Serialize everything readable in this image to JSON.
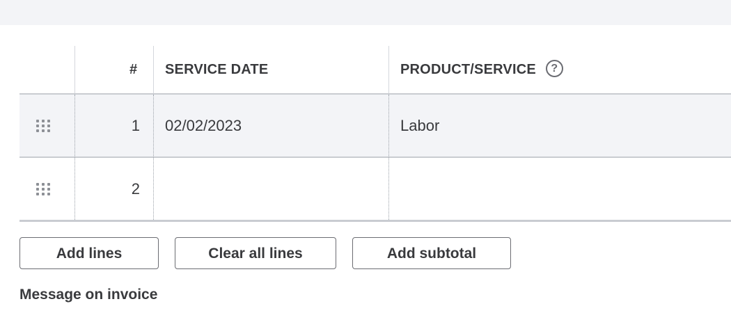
{
  "table": {
    "headers": {
      "number": "#",
      "service_date": "SERVICE DATE",
      "product_service": "PRODUCT/SERVICE",
      "help_glyph": "?"
    },
    "rows": [
      {
        "number": "1",
        "service_date": "02/02/2023",
        "product_service": "Labor"
      },
      {
        "number": "2",
        "service_date": "",
        "product_service": ""
      }
    ]
  },
  "actions": {
    "add_lines": "Add lines",
    "clear_all_lines": "Clear all lines",
    "add_subtotal": "Add subtotal"
  },
  "message_section": {
    "label": "Message on invoice"
  },
  "icons": {
    "drag_handle": "drag-handle-icon",
    "help": "help-circle-icon"
  },
  "colors": {
    "top_band": "#f3f4f7",
    "selected_row": "#f3f4f7",
    "text": "#393a3d",
    "border": "#c9ccd1"
  }
}
